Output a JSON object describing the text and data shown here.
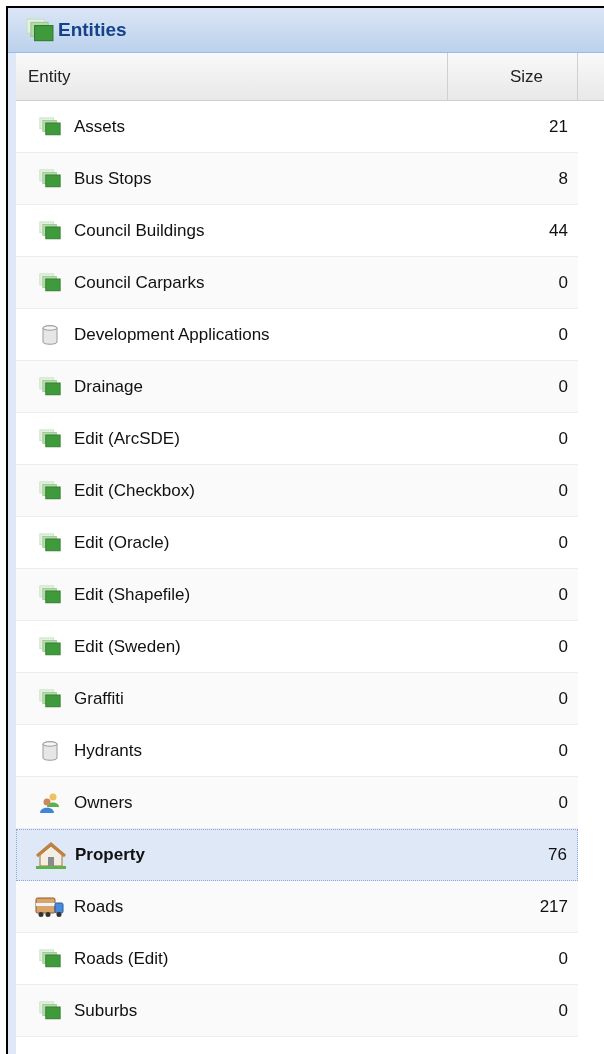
{
  "panel": {
    "title": "Entities"
  },
  "table": {
    "columns": [
      "Entity",
      "Size"
    ],
    "rows": [
      {
        "name": "Assets",
        "size": "21",
        "kind": "layers",
        "selected": false
      },
      {
        "name": "Bus Stops",
        "size": "8",
        "kind": "layers",
        "selected": false
      },
      {
        "name": "Council Buildings",
        "size": "44",
        "kind": "layers",
        "selected": false
      },
      {
        "name": "Council Carparks",
        "size": "0",
        "kind": "layers",
        "selected": false
      },
      {
        "name": "Development Applications",
        "size": "0",
        "kind": "database",
        "selected": false
      },
      {
        "name": "Drainage",
        "size": "0",
        "kind": "layers",
        "selected": false
      },
      {
        "name": "Edit (ArcSDE)",
        "size": "0",
        "kind": "layers",
        "selected": false
      },
      {
        "name": "Edit (Checkbox)",
        "size": "0",
        "kind": "layers",
        "selected": false
      },
      {
        "name": "Edit (Oracle)",
        "size": "0",
        "kind": "layers",
        "selected": false
      },
      {
        "name": "Edit (Shapefile)",
        "size": "0",
        "kind": "layers",
        "selected": false
      },
      {
        "name": "Edit (Sweden)",
        "size": "0",
        "kind": "layers",
        "selected": false
      },
      {
        "name": "Graffiti",
        "size": "0",
        "kind": "layers",
        "selected": false
      },
      {
        "name": "Hydrants",
        "size": "0",
        "kind": "database",
        "selected": false
      },
      {
        "name": "Owners",
        "size": "0",
        "kind": "users",
        "selected": false
      },
      {
        "name": "Property",
        "size": "76",
        "kind": "house",
        "selected": true
      },
      {
        "name": "Roads",
        "size": "217",
        "kind": "truck",
        "selected": false
      },
      {
        "name": "Roads (Edit)",
        "size": "0",
        "kind": "layers",
        "selected": false
      },
      {
        "name": "Suburbs",
        "size": "0",
        "kind": "layers",
        "selected": false
      }
    ]
  }
}
